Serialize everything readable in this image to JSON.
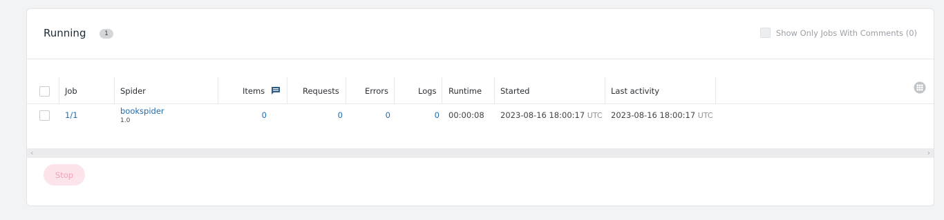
{
  "header": {
    "title": "Running",
    "count": "1",
    "comments_filter_label": "Show Only Jobs With Comments (0)"
  },
  "table": {
    "columns": [
      "Job",
      "Spider",
      "Items",
      "Requests",
      "Errors",
      "Logs",
      "Runtime",
      "Started",
      "Last activity"
    ],
    "rows": [
      {
        "job": "1/1",
        "spider": "bookspider",
        "spider_version": "1.0",
        "items": "0",
        "requests": "0",
        "errors": "0",
        "logs": "0",
        "runtime": "00:00:08",
        "started": "2023-08-16 18:00:17",
        "started_tz": "UTC",
        "last_activity": "2023-08-16 18:00:17",
        "last_activity_tz": "UTC"
      }
    ]
  },
  "scrollbar": {
    "left_arrow": "‹",
    "right_arrow": "›"
  },
  "actions": {
    "stop_label": "Stop"
  },
  "icons": {
    "items_column": "comment-icon",
    "column_settings": "grid-icon"
  },
  "colors": {
    "link": "#1f6bb0",
    "stop_bg": "#fde3ea",
    "stop_text": "#f0a3b6"
  }
}
